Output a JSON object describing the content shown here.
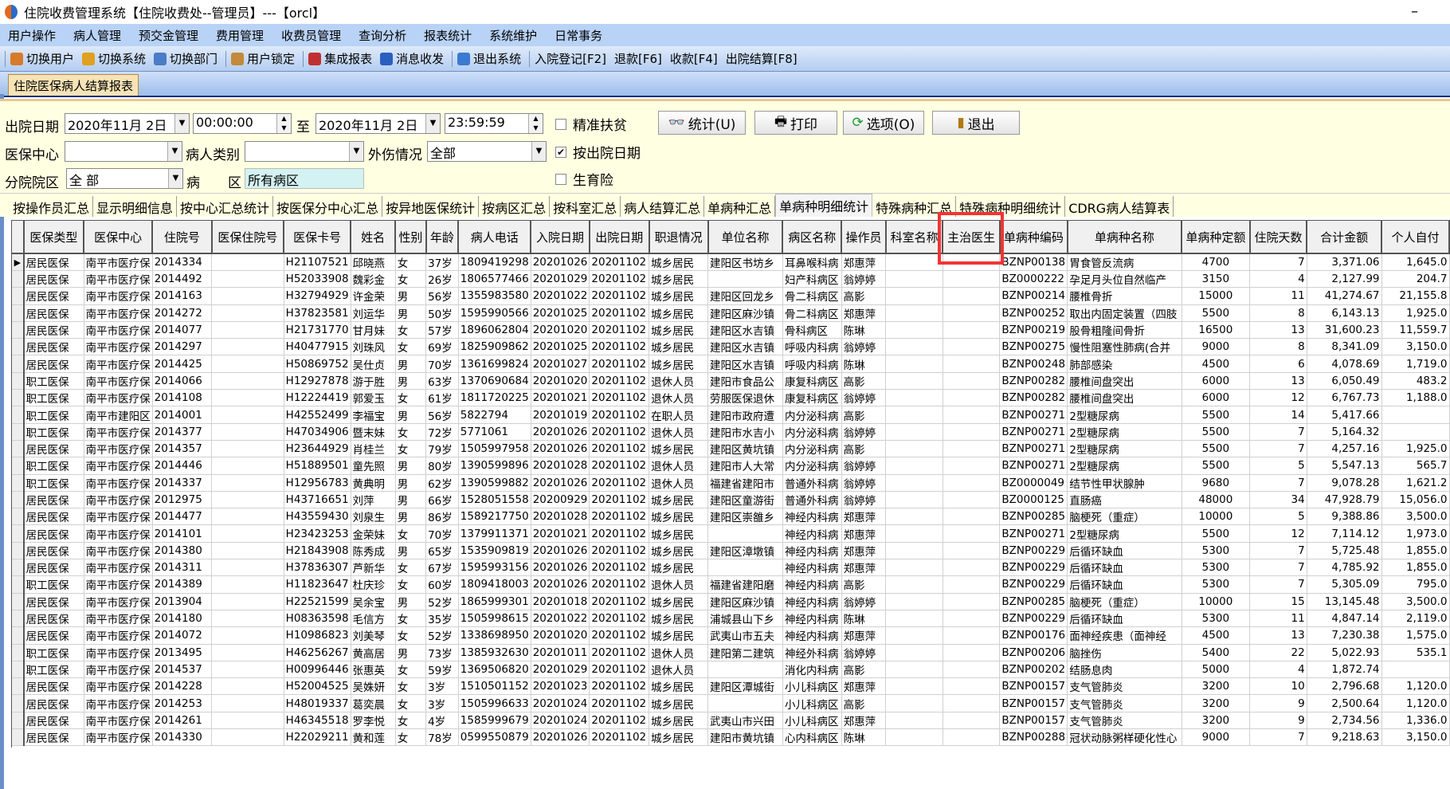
{
  "window": {
    "title": "住院收费管理系统【住院收费处--管理员】---【orcl】",
    "minimize": "–"
  },
  "menu": [
    "用户操作",
    "病人管理",
    "预交金管理",
    "费用管理",
    "收费员管理",
    "查询分析",
    "报表统计",
    "系统维护",
    "日常事务"
  ],
  "toolbar": [
    {
      "label": "切换用户",
      "icon": "switch-user-icon",
      "color": "#d77a2a"
    },
    {
      "label": "切换系统",
      "icon": "switch-system-icon",
      "color": "#e0a020"
    },
    {
      "label": "切换部门",
      "icon": "switch-dept-icon",
      "color": "#4a7cc8"
    },
    {
      "label": "用户锁定",
      "icon": "lock-user-icon",
      "color": "#c28a3a"
    },
    {
      "label": "集成报表",
      "icon": "report-icon",
      "color": "#c03030"
    },
    {
      "label": "消息收发",
      "icon": "info-icon",
      "color": "#2a5fc0"
    },
    {
      "label": "退出系统",
      "icon": "exit-icon",
      "color": "#3a7ad0"
    },
    {
      "label": "入院登记[F2]"
    },
    {
      "label": "退款[F6]"
    },
    {
      "label": "收款[F4]"
    },
    {
      "label": "出院结算[F8]"
    }
  ],
  "doc_tab": "住院医保病人结算报表",
  "filters": {
    "discharge_date_label": "出院日期",
    "date_from": "2020年11月 2日",
    "time_from": "00:00:00",
    "to_label": "至",
    "date_to": "2020年11月 2日",
    "time_to": "23:59:59",
    "center_label": "医保中心",
    "center_value": "",
    "patient_type_label": "病人类别",
    "patient_type_value": "",
    "injury_label": "外伤情况",
    "injury_value": "全部",
    "branch_label": "分院院区",
    "branch_value": "全 部",
    "ward_label_1": "病",
    "ward_label_2": "区",
    "ward_value": "所有病区",
    "cb_poverty": "精准扶贫",
    "cb_poverty_checked": false,
    "cb_by_discharge": "按出院日期",
    "cb_by_discharge_checked": true,
    "cb_maternity": "生育险",
    "cb_maternity_checked": false
  },
  "buttons": {
    "stat": "统计(U)",
    "print": "打印",
    "options": "选项(O)",
    "exit": "退出"
  },
  "subtabs": [
    "按操作员汇总",
    "显示明细信息",
    "按中心汇总统计",
    "按医保分中心汇总",
    "按异地医保统计",
    "按病区汇总",
    "按科室汇总",
    "病人结算汇总",
    "单病种汇总",
    "单病种明细统计",
    "特殊病种汇总",
    "特殊病种明细统计",
    "CDRG病人结算表"
  ],
  "active_subtab": "单病种明细统计",
  "table": {
    "columns": [
      "医保类型",
      "医保中心",
      "住院号",
      "医保住院号",
      "医保卡号",
      "姓名",
      "性别",
      "年龄",
      "病人电话",
      "入院日期",
      "出院日期",
      "职退情况",
      "单位名称",
      "病区名称",
      "操作员",
      "科室名称",
      "主治医生",
      "单病种编码",
      "单病种名称",
      "单病种定额",
      "住院天数",
      "合计金额",
      "个人自付"
    ],
    "highlighted_column": "主治医生",
    "rows": [
      [
        "居民医保",
        "南平市医疗保",
        "2014334",
        "",
        "H21107521",
        "邱晓燕",
        "女",
        "37岁",
        "1809419298",
        "20201026",
        "20201102",
        "城乡居民",
        "建阳区书坊乡",
        "耳鼻喉科病",
        "郑惠萍",
        "",
        "",
        "BZNP00138",
        "胃食管反流病",
        "4700",
        "7",
        "3,371.06",
        "1,645.0"
      ],
      [
        "居民医保",
        "南平市医疗保",
        "2014492",
        "",
        "H52033908",
        "魏彩金",
        "女",
        "26岁",
        "1806577466",
        "20201029",
        "20201102",
        "城乡居民",
        "",
        "妇产科病区",
        "翁婷婷",
        "",
        "",
        "BZ0000222",
        "孕足月头位自然临产",
        "3150",
        "4",
        "2,127.99",
        "204.7"
      ],
      [
        "居民医保",
        "南平市医疗保",
        "2014163",
        "",
        "H32794929",
        "许金荣",
        "男",
        "56岁",
        "1355983580",
        "20201022",
        "20201102",
        "城乡居民",
        "建阳区回龙乡",
        "骨二科病区",
        "高影",
        "",
        "",
        "BZNP00214",
        "腰椎骨折",
        "15000",
        "11",
        "41,274.67",
        "21,155.8"
      ],
      [
        "居民医保",
        "南平市医疗保",
        "2014272",
        "",
        "H37823581",
        "刘运华",
        "男",
        "50岁",
        "1595990566",
        "20201025",
        "20201102",
        "城乡居民",
        "建阳区麻沙镇",
        "骨二科病区",
        "郑惠萍",
        "",
        "",
        "BZNP00252",
        "取出内固定装置（四肢",
        "5500",
        "8",
        "6,143.13",
        "1,925.0"
      ],
      [
        "居民医保",
        "南平市医疗保",
        "2014077",
        "",
        "H21731770",
        "甘月妹",
        "女",
        "57岁",
        "1896062804",
        "20201020",
        "20201102",
        "城乡居民",
        "建阳区水吉镇",
        "骨科病区",
        "陈琳",
        "",
        "",
        "BZNP00219",
        "股骨粗隆间骨折",
        "16500",
        "13",
        "31,600.23",
        "11,559.7"
      ],
      [
        "居民医保",
        "南平市医疗保",
        "2014297",
        "",
        "H40477915",
        "刘珠风",
        "女",
        "69岁",
        "1825909862",
        "20201025",
        "20201102",
        "城乡居民",
        "建阳区水吉镇",
        "呼吸内科病",
        "翁婷婷",
        "",
        "",
        "BZNP00275",
        "慢性阻塞性肺病(合并",
        "9000",
        "8",
        "8,341.09",
        "3,150.0"
      ],
      [
        "居民医保",
        "南平市医疗保",
        "2014425",
        "",
        "H50869752",
        "吴仕贞",
        "男",
        "70岁",
        "1361699824",
        "20201027",
        "20201102",
        "城乡居民",
        "建阳区水吉镇",
        "呼吸内科病",
        "陈琳",
        "",
        "",
        "BZNP00248",
        "肺部感染",
        "4500",
        "6",
        "4,078.69",
        "1,719.0"
      ],
      [
        "职工医保",
        "南平市医疗保",
        "2014066",
        "",
        "H12927878",
        "游于胜",
        "男",
        "63岁",
        "1370690684",
        "20201020",
        "20201102",
        "退休人员",
        "建阳市食品公",
        "康复科病区",
        "高影",
        "",
        "",
        "BZNP00282",
        "腰椎间盘突出",
        "6000",
        "13",
        "6,050.49",
        "483.2"
      ],
      [
        "职工医保",
        "南平市医疗保",
        "2014108",
        "",
        "H12224419",
        "郭爱玉",
        "女",
        "61岁",
        "1811720225",
        "20201021",
        "20201102",
        "退休人员",
        "劳服医保退休",
        "康复科病区",
        "翁婷婷",
        "",
        "",
        "BZNP00282",
        "腰椎间盘突出",
        "6000",
        "12",
        "6,767.73",
        "1,188.0"
      ],
      [
        "职工医保",
        "南平市建阳区",
        "2014001",
        "",
        "H42552499",
        "李福宝",
        "男",
        "56岁",
        "5822794",
        "20201019",
        "20201102",
        "在职人员",
        "建阳市政府遭",
        "内分泌科病",
        "高影",
        "",
        "",
        "BZNP00271",
        "2型糖尿病",
        "5500",
        "14",
        "5,417.66",
        ""
      ],
      [
        "职工医保",
        "南平市医疗保",
        "2014377",
        "",
        "H47034906",
        "暨末妹",
        "女",
        "72岁",
        "5771061",
        "20201026",
        "20201102",
        "退休人员",
        "建阳市水吉小",
        "内分泌科病",
        "翁婷婷",
        "",
        "",
        "BZNP00271",
        "2型糖尿病",
        "5500",
        "7",
        "5,164.32",
        ""
      ],
      [
        "居民医保",
        "南平市医疗保",
        "2014357",
        "",
        "H23644929",
        "肖桂兰",
        "女",
        "79岁",
        "1505997958",
        "20201026",
        "20201102",
        "城乡居民",
        "建阳区黄坑镇",
        "内分泌科病",
        "高影",
        "",
        "",
        "BZNP00271",
        "2型糖尿病",
        "5500",
        "7",
        "4,257.16",
        "1,925.0"
      ],
      [
        "职工医保",
        "南平市医疗保",
        "2014446",
        "",
        "H51889501",
        "童先照",
        "男",
        "80岁",
        "1390599896",
        "20201028",
        "20201102",
        "退休人员",
        "建阳市人大常",
        "内分泌科病",
        "翁婷婷",
        "",
        "",
        "BZNP00271",
        "2型糖尿病",
        "5500",
        "5",
        "5,547.13",
        "565.7"
      ],
      [
        "职工医保",
        "南平市医疗保",
        "2014337",
        "",
        "H12956783",
        "黄典明",
        "男",
        "62岁",
        "1390599882",
        "20201026",
        "20201102",
        "退休人员",
        "福建省建阳市",
        "普通外科病",
        "翁婷婷",
        "",
        "",
        "BZ0000049",
        "结节性甲状腺肿",
        "9680",
        "7",
        "9,078.28",
        "1,621.2"
      ],
      [
        "居民医保",
        "南平市医疗保",
        "2012975",
        "",
        "H43716651",
        "刘萍",
        "男",
        "66岁",
        "1528051558",
        "20200929",
        "20201102",
        "城乡居民",
        "建阳区童游街",
        "普通外科病",
        "翁婷婷",
        "",
        "",
        "BZ0000125",
        "直肠癌",
        "48000",
        "34",
        "47,928.79",
        "15,056.0"
      ],
      [
        "居民医保",
        "南平市医疗保",
        "2014477",
        "",
        "H43559430",
        "刘泉生",
        "男",
        "86岁",
        "1589217750",
        "20201028",
        "20201102",
        "城乡居民",
        "建阳区崇雒乡",
        "神经内科病",
        "郑惠萍",
        "",
        "",
        "BZNP00285",
        "脑梗死（重症）",
        "10000",
        "5",
        "9,388.86",
        "3,500.0"
      ],
      [
        "居民医保",
        "南平市医疗保",
        "2014101",
        "",
        "H23423253",
        "金荣妹",
        "女",
        "70岁",
        "1379911371",
        "20201021",
        "20201102",
        "城乡居民",
        "",
        "神经内科病",
        "郑惠萍",
        "",
        "",
        "BZNP00271",
        "2型糖尿病",
        "5500",
        "12",
        "7,114.12",
        "1,973.0"
      ],
      [
        "居民医保",
        "南平市医疗保",
        "2014380",
        "",
        "H21843908",
        "陈秀成",
        "男",
        "65岁",
        "1535909819",
        "20201026",
        "20201102",
        "城乡居民",
        "建阳区漳墩镇",
        "神经内科病",
        "郑惠萍",
        "",
        "",
        "BZNP00229",
        "后循环缺血",
        "5300",
        "7",
        "5,725.48",
        "1,855.0"
      ],
      [
        "居民医保",
        "南平市医疗保",
        "2014311",
        "",
        "H37836307",
        "芦新华",
        "女",
        "67岁",
        "1595993156",
        "20201026",
        "20201102",
        "城乡居民",
        "",
        "神经内科病",
        "郑惠萍",
        "",
        "",
        "BZNP00229",
        "后循环缺血",
        "5300",
        "7",
        "4,785.92",
        "1,855.0"
      ],
      [
        "职工医保",
        "南平市医疗保",
        "2014389",
        "",
        "H11823647",
        "杜庆珍",
        "女",
        "60岁",
        "1809418003",
        "20201026",
        "20201102",
        "退休人员",
        "福建省建阳磨",
        "神经内科病",
        "高影",
        "",
        "",
        "BZNP00229",
        "后循环缺血",
        "5300",
        "7",
        "5,305.09",
        "795.0"
      ],
      [
        "居民医保",
        "南平市医疗保",
        "2013904",
        "",
        "H22521599",
        "吴余宝",
        "男",
        "52岁",
        "1865999301",
        "20201018",
        "20201102",
        "城乡居民",
        "建阳区麻沙镇",
        "神经内科病",
        "翁婷婷",
        "",
        "",
        "BZNP00285",
        "脑梗死（重症）",
        "10000",
        "15",
        "13,145.48",
        "3,500.0"
      ],
      [
        "居民医保",
        "南平市医疗保",
        "2014180",
        "",
        "H08363598",
        "毛信方",
        "女",
        "35岁",
        "1505998615",
        "20201022",
        "20201102",
        "城乡居民",
        "浦城县山下乡",
        "神经内科病",
        "陈琳",
        "",
        "",
        "BZNP00229",
        "后循环缺血",
        "5300",
        "11",
        "4,847.14",
        "2,119.0"
      ],
      [
        "居民医保",
        "南平市医疗保",
        "2014072",
        "",
        "H10986823",
        "刘美琴",
        "女",
        "52岁",
        "1338698950",
        "20201020",
        "20201102",
        "城乡居民",
        "武夷山市五夫",
        "神经内科病",
        "郑惠萍",
        "",
        "",
        "BZNP00176",
        "面神经疾患（面神经",
        "4500",
        "13",
        "7,230.38",
        "1,575.0"
      ],
      [
        "职工医保",
        "南平市医疗保",
        "2013495",
        "",
        "H46256267",
        "黄高居",
        "男",
        "73岁",
        "1385932630",
        "20201011",
        "20201102",
        "退休人员",
        "建阳第二建筑",
        "神经外科病",
        "翁婷婷",
        "",
        "",
        "BZNP00206",
        "脑挫伤",
        "5400",
        "22",
        "5,022.93",
        "535.1"
      ],
      [
        "职工医保",
        "南平市医疗保",
        "2014537",
        "",
        "H00996446",
        "张惠英",
        "女",
        "59岁",
        "1369506820",
        "20201029",
        "20201102",
        "退休人员",
        "",
        "消化内科病",
        "高影",
        "",
        "",
        "BZNP00202",
        "结肠息肉",
        "5000",
        "4",
        "1,872.74",
        ""
      ],
      [
        "居民医保",
        "南平市医疗保",
        "2014228",
        "",
        "H52004525",
        "吴姝妍",
        "女",
        "3岁",
        "1510501152",
        "20201023",
        "20201102",
        "城乡居民",
        "建阳区潭城街",
        "小儿科病区",
        "郑惠萍",
        "",
        "",
        "BZNP00157",
        "支气管肺炎",
        "3200",
        "10",
        "2,796.68",
        "1,120.0"
      ],
      [
        "居民医保",
        "南平市医疗保",
        "2014253",
        "",
        "H48019337",
        "葛奕晨",
        "女",
        "3岁",
        "1505996633",
        "20201024",
        "20201102",
        "城乡居民",
        "",
        "小儿科病区",
        "高影",
        "",
        "",
        "BZNP00157",
        "支气管肺炎",
        "3200",
        "9",
        "2,500.64",
        "1,120.0"
      ],
      [
        "居民医保",
        "南平市医疗保",
        "2014261",
        "",
        "H46345518",
        "罗李悦",
        "女",
        "4岁",
        "1585999679",
        "20201024",
        "20201102",
        "城乡居民",
        "武夷山市兴田",
        "小儿科病区",
        "郑惠萍",
        "",
        "",
        "BZNP00157",
        "支气管肺炎",
        "3200",
        "9",
        "2,734.56",
        "1,336.0"
      ],
      [
        "居民医保",
        "南平市医疗保",
        "2014330",
        "",
        "H22029211",
        "黄和莲",
        "女",
        "78岁",
        "0599550879",
        "20201026",
        "20201102",
        "城乡居民",
        "建阳市黄坑镇",
        "心内科病区",
        "陈琳",
        "",
        "",
        "BZNP00288",
        "冠状动脉粥样硬化性心",
        "9000",
        "7",
        "9,218.63",
        "3,150.0"
      ]
    ]
  },
  "colors": {
    "menubar": "#b9d3f6",
    "panel": "#ffffe2",
    "highlight": "#f03535",
    "ward_field": "#d4f2f2"
  }
}
